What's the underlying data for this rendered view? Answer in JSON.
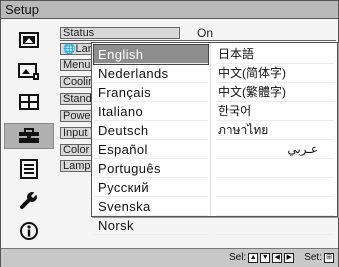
{
  "window": {
    "title": "Setup"
  },
  "sidebar": {
    "icons": [
      {
        "name": "picture-icon"
      },
      {
        "name": "picture-settings-icon"
      },
      {
        "name": "screen-icon"
      },
      {
        "name": "setup-toolbox-icon",
        "selected": true
      },
      {
        "name": "function-list-icon"
      },
      {
        "name": "wrench-icon"
      },
      {
        "name": "info-icon"
      }
    ]
  },
  "menu": {
    "items": [
      {
        "label": "Status",
        "value": "On"
      },
      {
        "label": "Language"
      },
      {
        "label": "Menu Position"
      },
      {
        "label": "Cooling Setting"
      },
      {
        "label": "Standby Mode"
      },
      {
        "label": "Power Saving"
      },
      {
        "label": "Input Terminal"
      },
      {
        "label": "Color System"
      },
      {
        "label": "Lamp Timer"
      }
    ]
  },
  "language_popup": {
    "left": [
      "English",
      "Nederlands",
      "Français",
      "Italiano",
      "Deutsch",
      "Español",
      "Português",
      "Русский",
      "Svenska",
      "Norsk"
    ],
    "right": [
      "日本語",
      "中文(简体字)",
      "中文(繁體字)",
      "한국어",
      "ภาษาไทย",
      "عـربي"
    ],
    "selected": "English"
  },
  "footer": {
    "select_label": "Sel:",
    "set_label": "Set:"
  }
}
